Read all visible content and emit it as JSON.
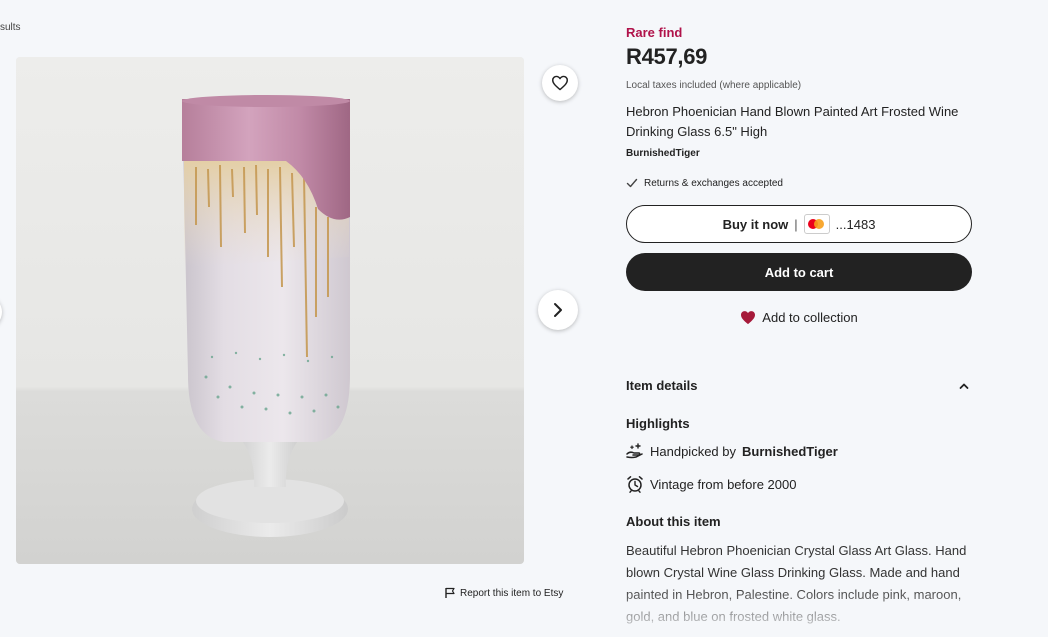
{
  "breadcrumb": {
    "text": "sults"
  },
  "listing": {
    "rare_find": "Rare find",
    "price": "R457,69",
    "taxes_note": "Local taxes included (where applicable)",
    "title": "Hebron Phoenician Hand Blown Painted Art Frosted Wine Drinking Glass 6.5\" High",
    "shop_name": "BurnishedTiger",
    "returns": "Returns & exchanges accepted"
  },
  "actions": {
    "buy_now_label": "Buy it now",
    "card_separator": "|",
    "card_last4": "...1483",
    "add_to_cart": "Add to cart",
    "add_to_collection": "Add to collection",
    "report": "Report this item to Etsy"
  },
  "details": {
    "item_details_label": "Item details",
    "highlights_title": "Highlights",
    "handpicked_prefix": "Handpicked by",
    "handpicked_shop": "BurnishedTiger",
    "vintage": "Vintage from before 2000",
    "about_title": "About this item",
    "about_text": "Beautiful Hebron Phoenician Crystal Glass Art Glass. Hand blown Crystal Wine Glass Drinking Glass. Made and hand painted in Hebron, Palestine. Colors include pink, maroon, gold, and blue on frosted white glass."
  },
  "icons": {
    "favorite": "heart-outline-icon",
    "next": "chevron-right-icon",
    "report": "flag-icon",
    "returns": "checkmark-icon",
    "collection": "heart-filled-icon",
    "collapse": "chevron-up-icon",
    "handpicked": "hand-sparkle-icon",
    "vintage": "alarm-clock-icon"
  },
  "colors": {
    "rare_find": "#b0124a",
    "collection_heart": "#a61a3a",
    "cart_button": "#222222",
    "background": "#f5f7fa"
  }
}
